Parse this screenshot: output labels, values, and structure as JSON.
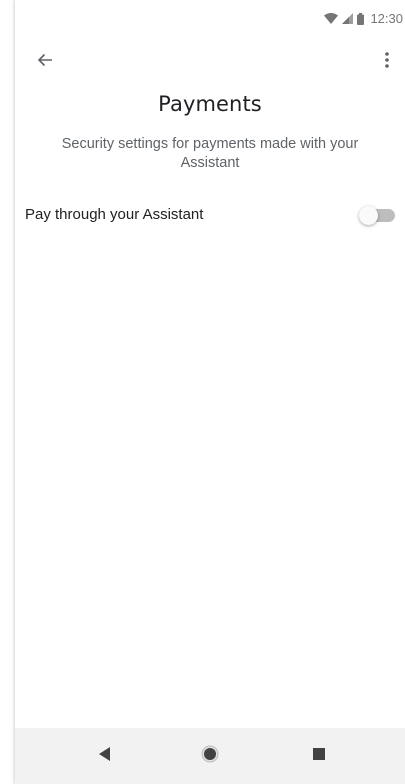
{
  "status_bar": {
    "time": "12:30",
    "icons": [
      "wifi-icon",
      "signal-icon",
      "battery-icon"
    ]
  },
  "app_bar": {
    "back_icon": "arrow-back-icon",
    "more_icon": "more-vert-icon"
  },
  "header": {
    "title": "Payments",
    "subtitle": "Security settings for payments made with your Assistant"
  },
  "settings": [
    {
      "label": "Pay through your Assistant",
      "enabled": false
    }
  ],
  "nav_bar": {
    "icons": [
      "nav-back-icon",
      "nav-home-icon",
      "nav-recents-icon"
    ]
  },
  "colors": {
    "text_primary": "#202124",
    "text_secondary": "#5f6368",
    "toggle_track_off": "#bdbdbd",
    "nav_bar_bg": "#f2f2f2"
  }
}
